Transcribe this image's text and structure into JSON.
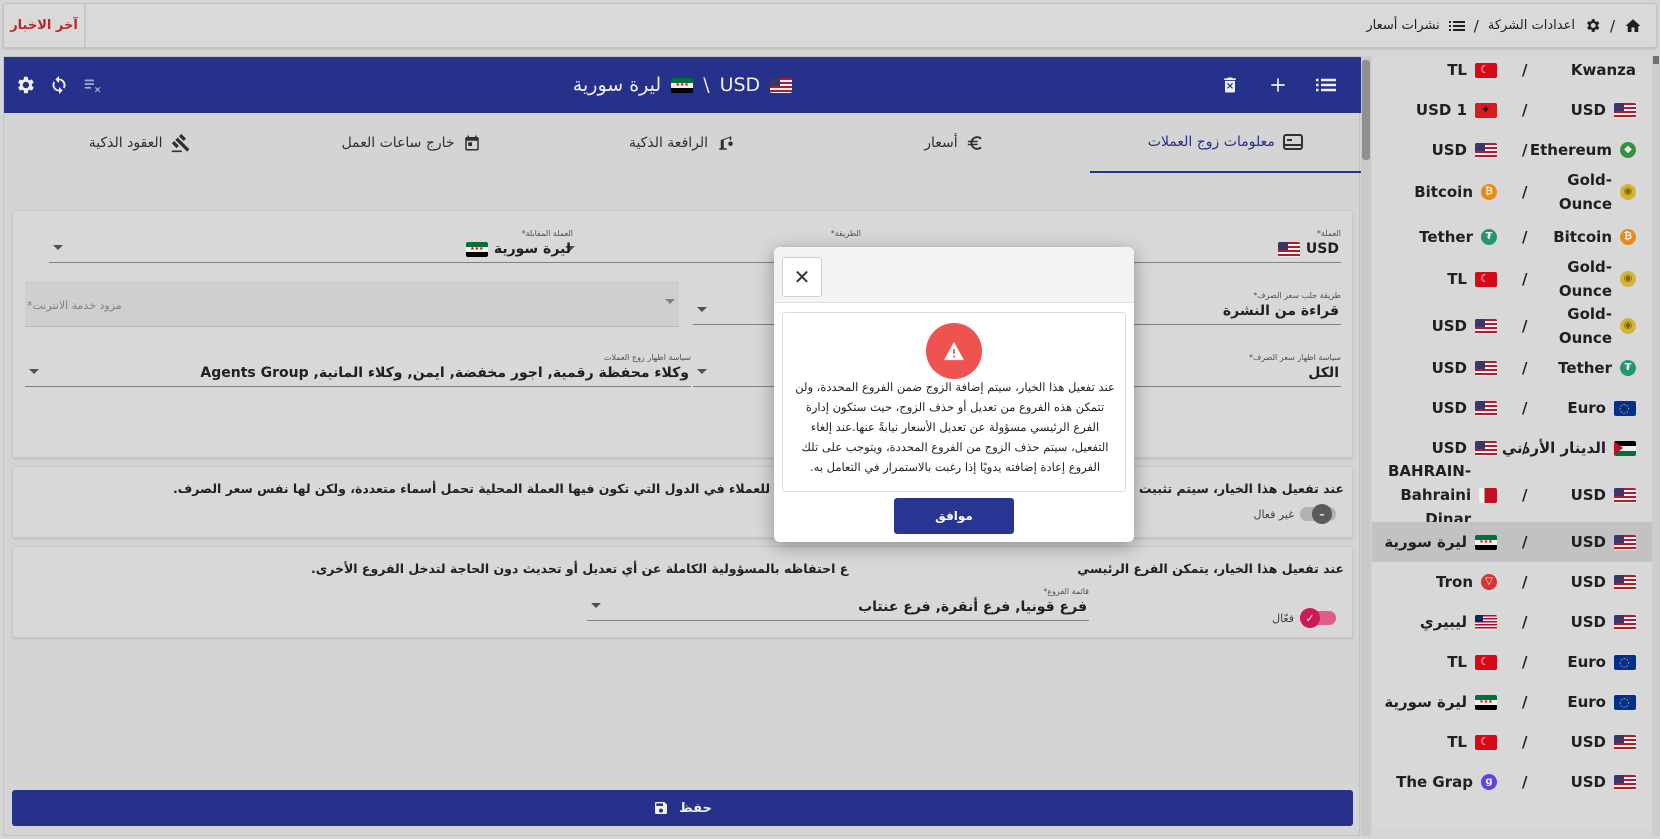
{
  "topbar": {
    "news_label": "آخر الاخبار",
    "crumb_company": "اعدادات الشركة",
    "crumb_rates": "نشرات أسعار",
    "crumb_sep": "/"
  },
  "header": {
    "base": "USD",
    "sep": "\\",
    "quote": "ليرة سورية"
  },
  "tabs": [
    {
      "label": "معلومات زوج العملات",
      "icon": "card-icon"
    },
    {
      "label": "أسعار",
      "icon": "euro-icon"
    },
    {
      "label": "الرافعة الذكية",
      "icon": "crane-icon"
    },
    {
      "label": "خارج ساعات العمل",
      "icon": "calendar-icon"
    },
    {
      "label": "العقود الذكية",
      "icon": "gavel-icon"
    }
  ],
  "form": {
    "currency_label": "العملة*",
    "currency_value": "USD",
    "method_label": "الطريقة*",
    "method_value": "\\",
    "counter_label": "العملة المقابلة*",
    "counter_value": "ليرة سورية",
    "fetch_label": "طريقة جلب سعر الصرف*",
    "fetch_value": "قراءة من النشرة",
    "provider_placeholder": "مزود خدمة الانترنت*",
    "display_policy_label": "سياسة اظهار سعر الصرف*",
    "display_policy_value": "الكل",
    "pair_policy_label": "سياسة اظهار زوج العملات",
    "pair_policy_value": "وكلاء محفظة رقمية, اجور مخفضة, ايمن, وكلاء المانية, Agents Group"
  },
  "option1": {
    "text_right": "عند تفعيل هذا الخيار، سيتم تثبيت سعر الص",
    "text_left": "ف. هذا الخيار مفيد للعملاء في الدول التي تكون فيها العملة المحلية تحمل أسماء متعددة، ولكن لها نفس سعر الصرف.",
    "toggle_label": "غير فعال"
  },
  "option2": {
    "text_right": "عند تفعيل هذا الخيار، يتمكن الفرع الرئيسي",
    "text_left": "ع احتفاظه بالمسؤولية الكاملة عن أي تعديل أو تحديث دون الحاجة لتدخل الفروع الأخرى.",
    "branches_label": "قائمة الفروع*",
    "branches_value": "فرع قونيا, فرع أنقرة, فرع عنتاب",
    "toggle_label": "فعّال"
  },
  "save_label": "حفظ",
  "modal": {
    "message": "عند تفعيل هذا الخيار، سيتم إضافة الزوج ضمن الفروع المحددة، ولن تتمكن هذه الفروع من تعديل أو حذف الزوج، حيث ستكون إدارة الفرع الرئيسي مسؤولة عن تعديل الأسعار نيابةً عنها.عند إلغاء التفعيل، سيتم حذف الزوج من الفروع المحددة، ويتوجب على تلك الفروع إعادة إضافته يدويًا إذا رغبت بالاستمرار في التعامل به.",
    "ok_label": "موافق",
    "close_symbol": "✕"
  },
  "pairs": [
    {
      "left": "TL",
      "left_icon": "f-tr",
      "right": "Kwanza",
      "right_icon": ""
    },
    {
      "left": "USD 1",
      "left_icon": "f-al",
      "right": "USD",
      "right_icon": "f-us"
    },
    {
      "left": "USD",
      "left_icon": "f-us",
      "right": "Ethereum",
      "right_icon": "c-eth"
    },
    {
      "left": "Bitcoin",
      "left_icon": "c-btc",
      "right": "Gold-\nOunce",
      "right_icon": "c-gold"
    },
    {
      "left": "Tether",
      "left_icon": "c-usdt",
      "right": "Bitcoin",
      "right_icon": "c-btc"
    },
    {
      "left": "TL",
      "left_icon": "f-tr",
      "right": "Gold-\nOunce",
      "right_icon": "c-gold"
    },
    {
      "left": "USD",
      "left_icon": "f-us",
      "right": "Gold-\nOunce",
      "right_icon": "c-gold"
    },
    {
      "left": "USD",
      "left_icon": "f-us",
      "right": "Tether",
      "right_icon": "c-usdt"
    },
    {
      "left": "USD",
      "left_icon": "f-us",
      "right": "Euro",
      "right_icon": "f-eu"
    },
    {
      "left": "USD",
      "left_icon": "f-us",
      "right": "الدينار الأردني",
      "right_icon": "f-jo"
    },
    {
      "left": "BAHRAIN-\nBahraini Dinar",
      "left_icon": "f-bh",
      "right": "USD",
      "right_icon": "f-us"
    },
    {
      "left": "ليرة سورية",
      "left_icon": "f-sy",
      "right": "USD",
      "right_icon": "f-us"
    },
    {
      "left": "Tron",
      "left_icon": "c-tron",
      "right": "USD",
      "right_icon": "f-us"
    },
    {
      "left": "ليبيري",
      "left_icon": "f-lr",
      "right": "USD",
      "right_icon": "f-us"
    },
    {
      "left": "TL",
      "left_icon": "f-tr",
      "right": "Euro",
      "right_icon": "f-eu"
    },
    {
      "left": "ليرة سورية",
      "left_icon": "f-sy",
      "right": "Euro",
      "right_icon": "f-eu"
    },
    {
      "left": "TL",
      "left_icon": "f-tr",
      "right": "USD",
      "right_icon": "f-us"
    },
    {
      "left": "The Grap",
      "left_icon": "c-grt",
      "right": "USD",
      "right_icon": "f-us"
    }
  ],
  "selected_pair_index": 11,
  "colors": {
    "primary": "#283593",
    "danger": "#ef5350",
    "news": "#c62828",
    "toggle_on": "#d81b60"
  }
}
